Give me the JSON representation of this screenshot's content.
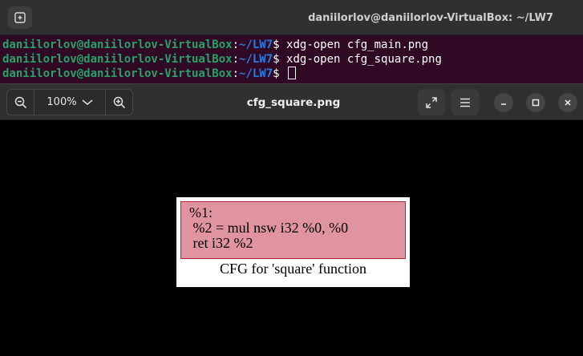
{
  "terminal": {
    "title": "daniilorlov@daniilorlov-VirtualBox: ~/LW7",
    "prompt_user": "daniilorlov@daniilorlov-VirtualBox",
    "prompt_sep": ":",
    "prompt_path": "~/LW7",
    "prompt_symbol": "$",
    "lines": [
      {
        "command": " xdg-open cfg_main.png"
      },
      {
        "command": " xdg-open cfg_square.png"
      },
      {
        "command": " "
      }
    ]
  },
  "viewer": {
    "title": "cfg_square.png",
    "zoom_level": "100%"
  },
  "cfg": {
    "node_lines": [
      "%1:",
      " %2 = mul nsw i32 %0, %0",
      " ret i32 %2"
    ],
    "caption": "CFG for 'square' function"
  },
  "colors": {
    "terminal_bg": "#300a24",
    "prompt_user": "#26a269",
    "prompt_path": "#2a7bde",
    "node_fill": "#e0949f",
    "node_border": "#b3263a"
  },
  "icons": {
    "new_tab": "new-tab-icon",
    "zoom_out": "zoom-out-icon",
    "zoom_in": "zoom-in-icon",
    "chevron": "chevron-down-icon",
    "fullscreen": "fullscreen-icon",
    "menu": "hamburger-menu-icon",
    "minimize": "minimize-icon",
    "maximize": "maximize-icon",
    "close": "close-icon"
  }
}
